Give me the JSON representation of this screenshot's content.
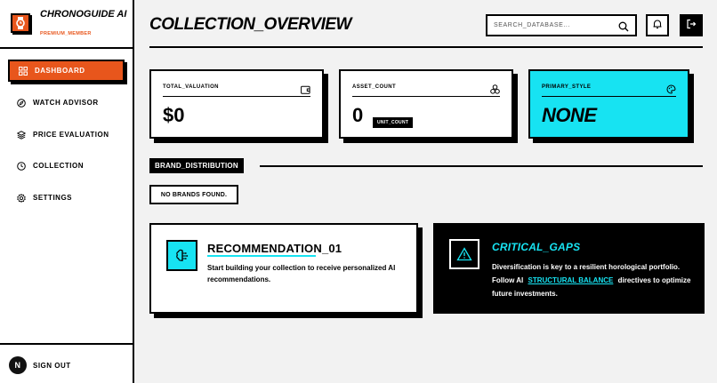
{
  "app": {
    "title": "CHRONOGUIDE AI",
    "subtitle": "PREMIUM_MEMBER",
    "logo_icon": "watch-icon",
    "accent": "#e8561c",
    "cyan": "#17e3f2"
  },
  "sidebar": {
    "items": [
      {
        "label": "DASHBOARD",
        "icon": "grid-icon",
        "active": true
      },
      {
        "label": "WATCH ADVISOR",
        "icon": "compass-icon",
        "active": false
      },
      {
        "label": "PRICE EVALUATION",
        "icon": "layers-icon",
        "active": false
      },
      {
        "label": "COLLECTION",
        "icon": "clock-icon",
        "active": false
      },
      {
        "label": "SETTINGS",
        "icon": "gear-icon",
        "active": false
      }
    ],
    "signout": {
      "avatar_letter": "N",
      "label": "SIGN OUT"
    }
  },
  "header": {
    "title": "COLLECTION_OVERVIEW",
    "search_placeholder": "SEARCH_DATABASE...",
    "bell_icon": "bell-icon",
    "logout_icon": "logout-icon"
  },
  "stats": {
    "total_valuation": {
      "label": "TOTAL_VALUATION",
      "value": "$0",
      "icon": "wallet-icon"
    },
    "asset_count": {
      "label": "ASSET_COUNT",
      "value": "0",
      "unit": "UNIT_COUNT",
      "icon": "nodes-icon"
    },
    "primary_style": {
      "label": "PRIMARY_STYLE",
      "value": "NONE",
      "icon": "palette-icon"
    }
  },
  "brand_distribution": {
    "label": "BRAND_DISTRIBUTION",
    "empty": "NO BRANDS FOUND."
  },
  "recommendation": {
    "title": "RECOMMENDATION_01",
    "text": "Start building your collection to receive personalized AI recommendations.",
    "icon": "brain-icon"
  },
  "critical_gaps": {
    "title": "CRITICAL_GAPS",
    "text_before": "Diversification is key to a resilient horological portfolio. Follow AI",
    "link": "STRUCTURAL BALANCE",
    "text_after": "directives to optimize future investments.",
    "icon": "warning-icon"
  }
}
